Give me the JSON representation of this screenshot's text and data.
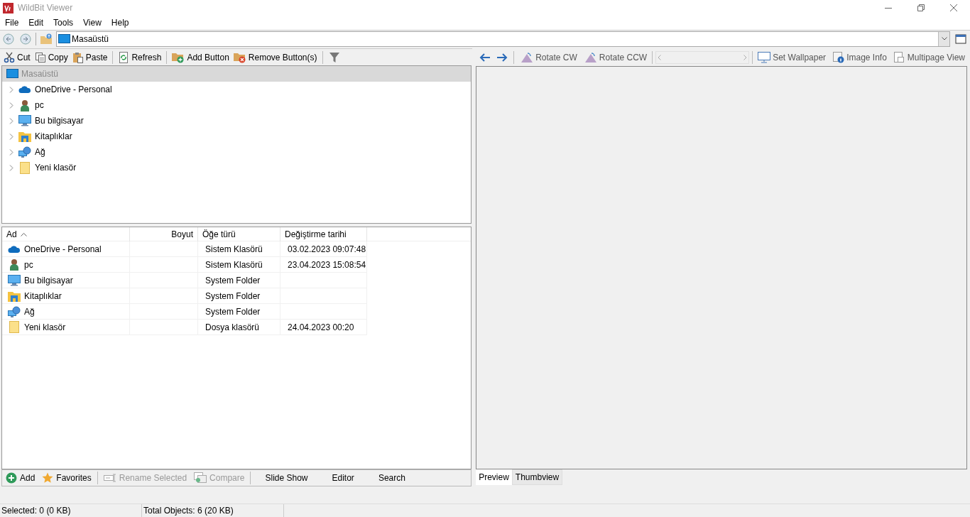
{
  "window": {
    "title": "WildBit Viewer"
  },
  "menu": [
    "File",
    "Edit",
    "Tools",
    "View",
    "Help"
  ],
  "address": {
    "value": "Masaüstü"
  },
  "file_toolbar": [
    {
      "kind": "cut",
      "label": "Cut"
    },
    {
      "kind": "copy",
      "label": "Copy"
    },
    {
      "kind": "paste",
      "label": "Paste"
    },
    {
      "kind": "refresh",
      "label": "Refresh"
    },
    {
      "kind": "add",
      "label": "Add Button"
    },
    {
      "kind": "remove",
      "label": "Remove Button(s)"
    }
  ],
  "tree": {
    "label": "Masaüstü",
    "selected": true,
    "children": [
      {
        "label": "OneDrive - Personal",
        "kind": "cloud",
        "selected": false
      },
      {
        "label": "pc",
        "kind": "user",
        "selected": false
      },
      {
        "label": "Bu bilgisayar",
        "kind": "computer",
        "selected": false
      },
      {
        "label": "Kitaplıklar",
        "kind": "library",
        "selected": false
      },
      {
        "label": "Ağ",
        "kind": "network",
        "selected": false
      },
      {
        "label": "Yeni klasör",
        "kind": "folder",
        "selected": false
      }
    ]
  },
  "table": {
    "columns": [
      "Ad",
      "Boyut",
      "Öğe türü",
      "Değiştirme tarihi"
    ],
    "rows": [
      {
        "kind": "cloud",
        "name": "OneDrive - Personal",
        "type": "Sistem Klasörü",
        "modified": "03.02.2023 09:07:48"
      },
      {
        "kind": "user",
        "name": "pc",
        "type": "Sistem Klasörü",
        "modified": "23.04.2023 15:08:54"
      },
      {
        "kind": "computer",
        "name": "Bu bilgisayar",
        "type": "System Folder"
      },
      {
        "kind": "library",
        "name": "Kitaplıklar",
        "type": "System Folder"
      },
      {
        "kind": "network",
        "name": "Ağ",
        "type": "System Folder"
      },
      {
        "kind": "folder",
        "name": "Yeni klasör",
        "type": "Dosya klasörü",
        "modified": "24.04.2023 00:20"
      }
    ]
  },
  "bottom_toolbar": [
    {
      "kind": "add",
      "label": "Add",
      "disabled": false
    },
    {
      "kind": "star",
      "label": "Favorites",
      "disabled": false
    },
    {
      "kind": "rename",
      "label": "Rename Selected",
      "disabled": true
    },
    {
      "kind": "compare",
      "label": "Compare",
      "disabled": true
    },
    {
      "kind": "text",
      "label": "Slide Show",
      "disabled": false
    },
    {
      "kind": "text",
      "label": "Editor",
      "disabled": false
    },
    {
      "kind": "text",
      "label": "Search",
      "disabled": false
    }
  ],
  "viewer_toolbar": [
    {
      "kind": "rotate",
      "label": "Rotate CW"
    },
    {
      "kind": "rotate",
      "label": "Rotate CCW"
    },
    {
      "kind": "wallpaper",
      "label": "Set Wallpaper"
    },
    {
      "kind": "info",
      "label": "Image Info"
    },
    {
      "kind": "multipage",
      "label": "Multipage View"
    }
  ],
  "viewer_tabs": [
    {
      "label": "Preview",
      "selected": true
    },
    {
      "label": "Thumbview",
      "selected": false
    }
  ],
  "status_bar": [
    "Selected: 0 (0 KB)",
    "Total Objects: 6 (20 KB)"
  ]
}
